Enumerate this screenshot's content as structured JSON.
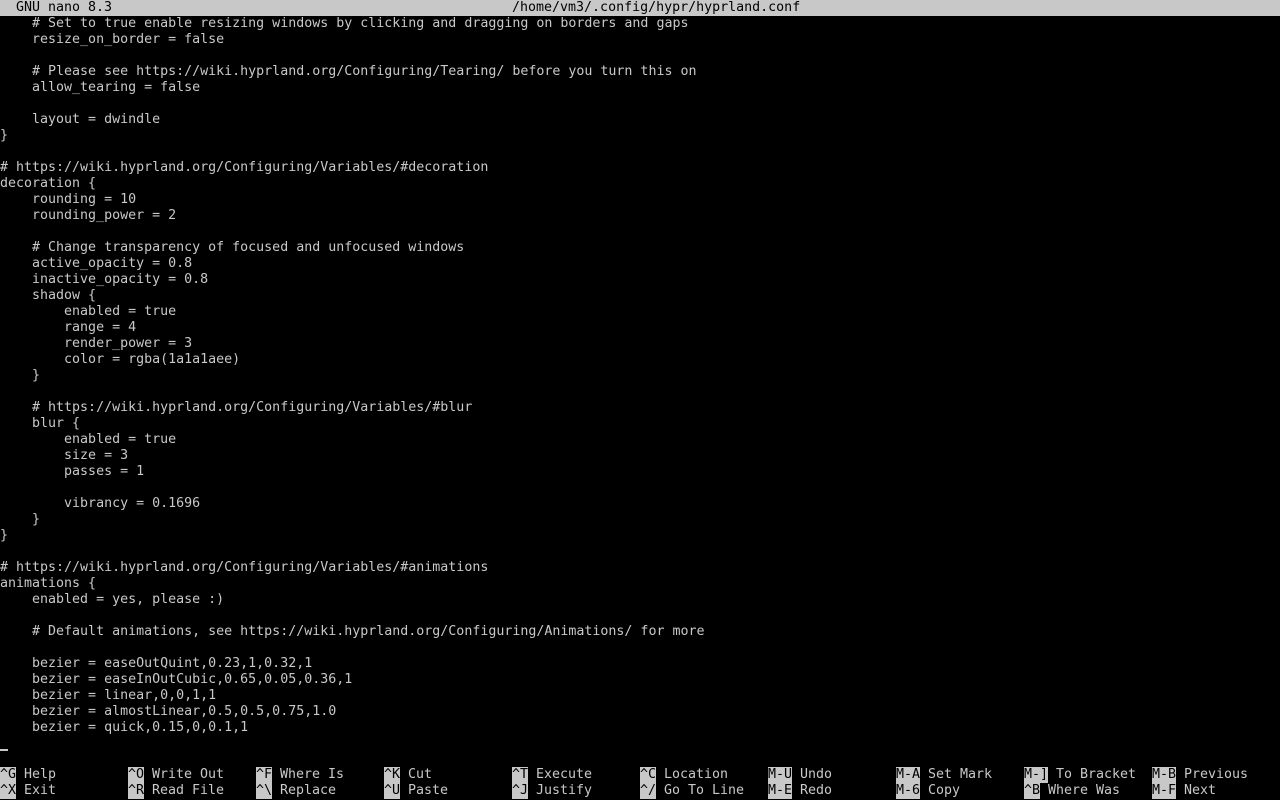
{
  "title_bar": {
    "app": "GNU nano 8.3",
    "file": "/home/vm3/.config/hypr/hyprland.conf"
  },
  "lines": [
    "    # Set to true enable resizing windows by clicking and dragging on borders and gaps",
    "    resize_on_border = false",
    "",
    "    # Please see https://wiki.hyprland.org/Configuring/Tearing/ before you turn this on",
    "    allow_tearing = false",
    "",
    "    layout = dwindle",
    "}",
    "",
    "# https://wiki.hyprland.org/Configuring/Variables/#decoration",
    "decoration {",
    "    rounding = 10",
    "    rounding_power = 2",
    "",
    "    # Change transparency of focused and unfocused windows",
    "    active_opacity = 0.8",
    "    inactive_opacity = 0.8",
    "    shadow {",
    "        enabled = true",
    "        range = 4",
    "        render_power = 3",
    "        color = rgba(1a1a1aee)",
    "    }",
    "",
    "    # https://wiki.hyprland.org/Configuring/Variables/#blur",
    "    blur {",
    "        enabled = true",
    "        size = 3",
    "        passes = 1",
    "",
    "        vibrancy = 0.1696",
    "    }",
    "}",
    "",
    "# https://wiki.hyprland.org/Configuring/Variables/#animations",
    "animations {",
    "    enabled = yes, please :)",
    "",
    "    # Default animations, see https://wiki.hyprland.org/Configuring/Animations/ for more",
    "",
    "    bezier = easeOutQuint,0.23,1,0.32,1",
    "    bezier = easeInOutCubic,0.65,0.05,0.36,1",
    "    bezier = linear,0,0,1,1",
    "    bezier = almostLinear,0.5,0.5,0.75,1.0",
    "    bezier = quick,0.15,0,0.1,1"
  ],
  "shortcuts_top": [
    {
      "key": "^G",
      "label": "Help"
    },
    {
      "key": "^O",
      "label": "Write Out"
    },
    {
      "key": "^F",
      "label": "Where Is"
    },
    {
      "key": "^K",
      "label": "Cut"
    },
    {
      "key": "^T",
      "label": "Execute"
    },
    {
      "key": "^C",
      "label": "Location"
    },
    {
      "key": "M-U",
      "label": "Undo"
    },
    {
      "key": "M-A",
      "label": "Set Mark"
    },
    {
      "key": "M-]",
      "label": "To Bracket"
    },
    {
      "key": "M-B",
      "label": "Previous"
    }
  ],
  "shortcuts_bottom": [
    {
      "key": "^X",
      "label": "Exit"
    },
    {
      "key": "^R",
      "label": "Read File"
    },
    {
      "key": "^\\",
      "label": "Replace"
    },
    {
      "key": "^U",
      "label": "Paste"
    },
    {
      "key": "^J",
      "label": "Justify"
    },
    {
      "key": "^/",
      "label": "Go To Line"
    },
    {
      "key": "M-E",
      "label": "Redo"
    },
    {
      "key": "M-6",
      "label": "Copy"
    },
    {
      "key": "^B",
      "label": "Where Was"
    },
    {
      "key": "M-F",
      "label": "Next"
    }
  ],
  "colors": {
    "background": "#000000",
    "foreground": "#c8c8c8",
    "inverse_bg": "#c8c8c8",
    "inverse_fg": "#000000"
  }
}
